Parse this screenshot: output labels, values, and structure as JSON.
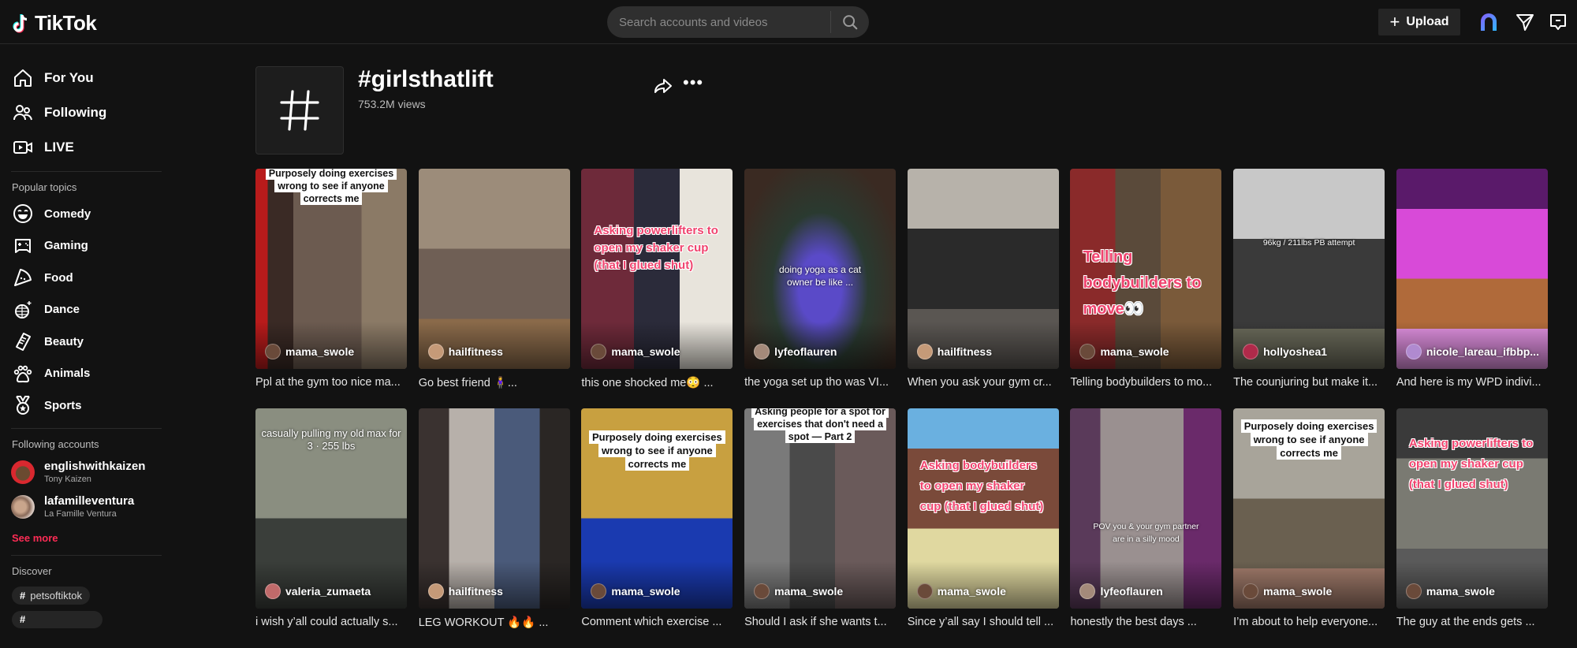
{
  "app": {
    "logo_text": "TikTok",
    "search_placeholder": "Search accounts and videos",
    "upload_label": "Upload",
    "accent_color": "#fe2c55"
  },
  "sidebar": {
    "main_nav": [
      {
        "label": "For You",
        "icon": "home-icon"
      },
      {
        "label": "Following",
        "icon": "users-icon"
      },
      {
        "label": "LIVE",
        "icon": "live-video-icon"
      }
    ],
    "popular_title": "Popular topics",
    "topics": [
      {
        "label": "Comedy",
        "icon": "laughing-face-icon"
      },
      {
        "label": "Gaming",
        "icon": "gamepad-icon"
      },
      {
        "label": "Food",
        "icon": "pizza-icon"
      },
      {
        "label": "Dance",
        "icon": "disco-ball-icon"
      },
      {
        "label": "Beauty",
        "icon": "comb-icon"
      },
      {
        "label": "Animals",
        "icon": "paw-icon"
      },
      {
        "label": "Sports",
        "icon": "medal-icon"
      }
    ],
    "following_title": "Following accounts",
    "accounts": [
      {
        "username": "englishwithkaizen",
        "name": "Tony Kaizen"
      },
      {
        "username": "lafamilleventura",
        "name": "La Famille Ventura"
      }
    ],
    "see_more": "See more",
    "discover_title": "Discover",
    "discover_tags": [
      "petsoftiktok"
    ]
  },
  "header": {
    "title": "#girlsthatlift",
    "views": "753.2M views"
  },
  "videos": [
    {
      "author": "mama_swole",
      "caption": "Ppl at the gym too nice ma...",
      "overlay": "Purposely doing exercises wrong to see if anyone corrects me",
      "overlay_style": "white-box"
    },
    {
      "author": "hailfitness",
      "caption": "Go best friend 🧍‍♀️...",
      "overlay": "",
      "overlay_style": "none"
    },
    {
      "author": "mama_swole",
      "caption": "this one shocked me😳 ...",
      "overlay": "Asking powerlifters to open my shaker cup (that I glued shut)",
      "overlay_style": "pink"
    },
    {
      "author": "lyfeoflauren",
      "caption": "the yoga set up tho was VI...",
      "overlay": "doing yoga as a cat owner be like ...",
      "overlay_style": "plain"
    },
    {
      "author": "hailfitness",
      "caption": "When you ask your gym cr...",
      "overlay": "",
      "overlay_style": "none"
    },
    {
      "author": "mama_swole",
      "caption": "Telling bodybuilders to mo...",
      "overlay": "Telling bodybuilders to move👀",
      "overlay_style": "pink"
    },
    {
      "author": "hollyoshea1",
      "caption": "The counjuring but make it...",
      "overlay": "96kg / 211lbs PB attempt",
      "overlay_style": "plain"
    },
    {
      "author": "nicole_lareau_ifbbp...",
      "caption": "And here is my WPD indivi...",
      "overlay": "",
      "overlay_style": "none"
    },
    {
      "author": "valeria_zumaeta",
      "caption": "i wish y’all could actually s...",
      "overlay": "casually pulling my old max for 3 · 255 lbs",
      "overlay_style": "plain"
    },
    {
      "author": "hailfitness",
      "caption": "LEG WORKOUT 🔥🔥 ...",
      "overlay": "",
      "overlay_style": "none"
    },
    {
      "author": "mama_swole",
      "caption": "Comment which exercise ...",
      "overlay": "Purposely doing exercises wrong to see if anyone corrects me",
      "overlay_style": "white-box"
    },
    {
      "author": "mama_swole",
      "caption": "Should I ask if she wants t...",
      "overlay": "Asking people for a spot for exercises that don't need a spot — Part 2",
      "overlay_style": "white-box"
    },
    {
      "author": "mama_swole",
      "caption": "Since y’all say I should tell ...",
      "overlay": "Asking bodybuilders to open my shaker cup (that I glued shut)",
      "overlay_style": "pink"
    },
    {
      "author": "lyfeoflauren",
      "caption": "honestly the best days ...",
      "overlay": "POV you & your gym partner are in a silly mood",
      "overlay_style": "plain"
    },
    {
      "author": "mama_swole",
      "caption": "I’m about to help everyone...",
      "overlay": "Purposely doing exercises wrong to see if anyone corrects me",
      "overlay_style": "white-box"
    },
    {
      "author": "mama_swole",
      "caption": "The guy at the ends gets ...",
      "overlay": "Asking powerlifters to open my shaker cup (that I glued shut)",
      "overlay_style": "pink"
    }
  ]
}
